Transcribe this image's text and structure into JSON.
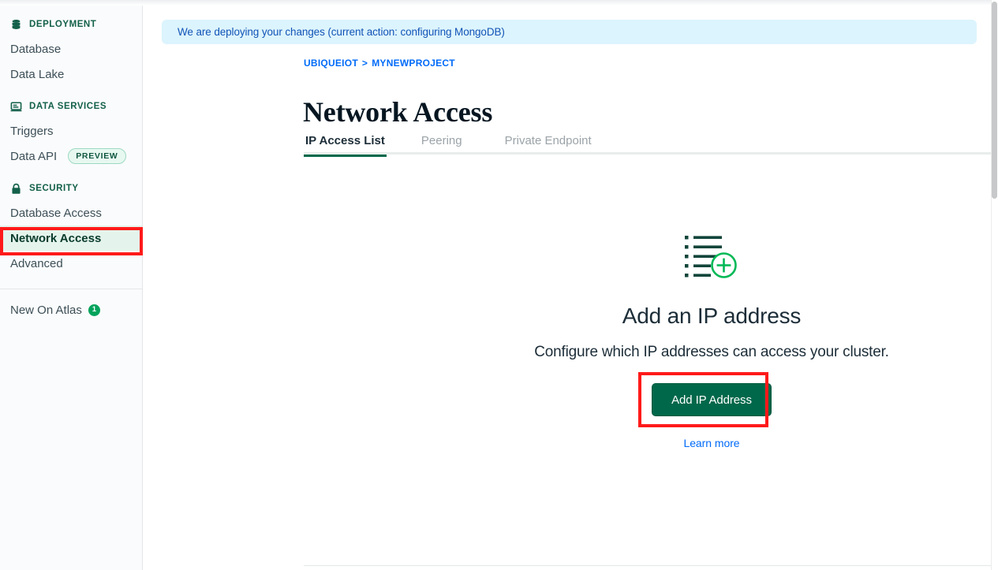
{
  "sidebar": {
    "sections": [
      {
        "id": "deployment",
        "label": "DEPLOYMENT",
        "icon": "database-icon",
        "items": [
          {
            "id": "database",
            "label": "Database",
            "selected": false,
            "badge": null
          },
          {
            "id": "data-lake",
            "label": "Data Lake",
            "selected": false,
            "badge": null
          }
        ]
      },
      {
        "id": "data-services",
        "label": "DATA SERVICES",
        "icon": "laptop-icon",
        "items": [
          {
            "id": "triggers",
            "label": "Triggers",
            "selected": false,
            "badge": null
          },
          {
            "id": "data-api",
            "label": "Data API",
            "selected": false,
            "badge": "PREVIEW"
          }
        ]
      },
      {
        "id": "security",
        "label": "SECURITY",
        "icon": "lock-icon",
        "items": [
          {
            "id": "database-access",
            "label": "Database Access",
            "selected": false,
            "badge": null
          },
          {
            "id": "network-access",
            "label": "Network Access",
            "selected": true,
            "badge": null
          },
          {
            "id": "advanced",
            "label": "Advanced",
            "selected": false,
            "badge": null
          }
        ]
      }
    ],
    "footer": {
      "id": "new-on-atlas",
      "label": "New On Atlas",
      "count": "1",
      "count_color": "#00a35c"
    },
    "highlight_color": "#ff1a1a",
    "selected_bg": "#e4f4ec"
  },
  "banner": {
    "text": "We are deploying your changes (current action: configuring MongoDB)",
    "bg_color": "#dcf4fd",
    "text_color": "#1254b7"
  },
  "breadcrumb": {
    "org": "UBIQUEIOT",
    "separator": ">",
    "project": "MYNEWPROJECT",
    "link_color": "#016bf8"
  },
  "header": {
    "title": "Network Access"
  },
  "tabs": [
    {
      "id": "ip-access-list",
      "label": "IP Access List",
      "active": true
    },
    {
      "id": "peering",
      "label": "Peering",
      "active": false
    },
    {
      "id": "private-endpoint",
      "label": "Private Endpoint",
      "active": false
    }
  ],
  "tabs_meta": {
    "active_underline_color": "#00684a",
    "inactive_color": "#9ba3a8"
  },
  "empty_state": {
    "icon": "add-to-list-icon",
    "title": "Add an IP address",
    "description": "Configure which IP addresses can access your cluster.",
    "button_label": "Add IP Address",
    "button_color": "#00684a",
    "link_label": "Learn more",
    "link_color": "#016bf8",
    "highlight_color": "#ff1a1a"
  },
  "scrollbar": {
    "orientation": "vertical",
    "thumb_color": "#c6c8c9"
  }
}
